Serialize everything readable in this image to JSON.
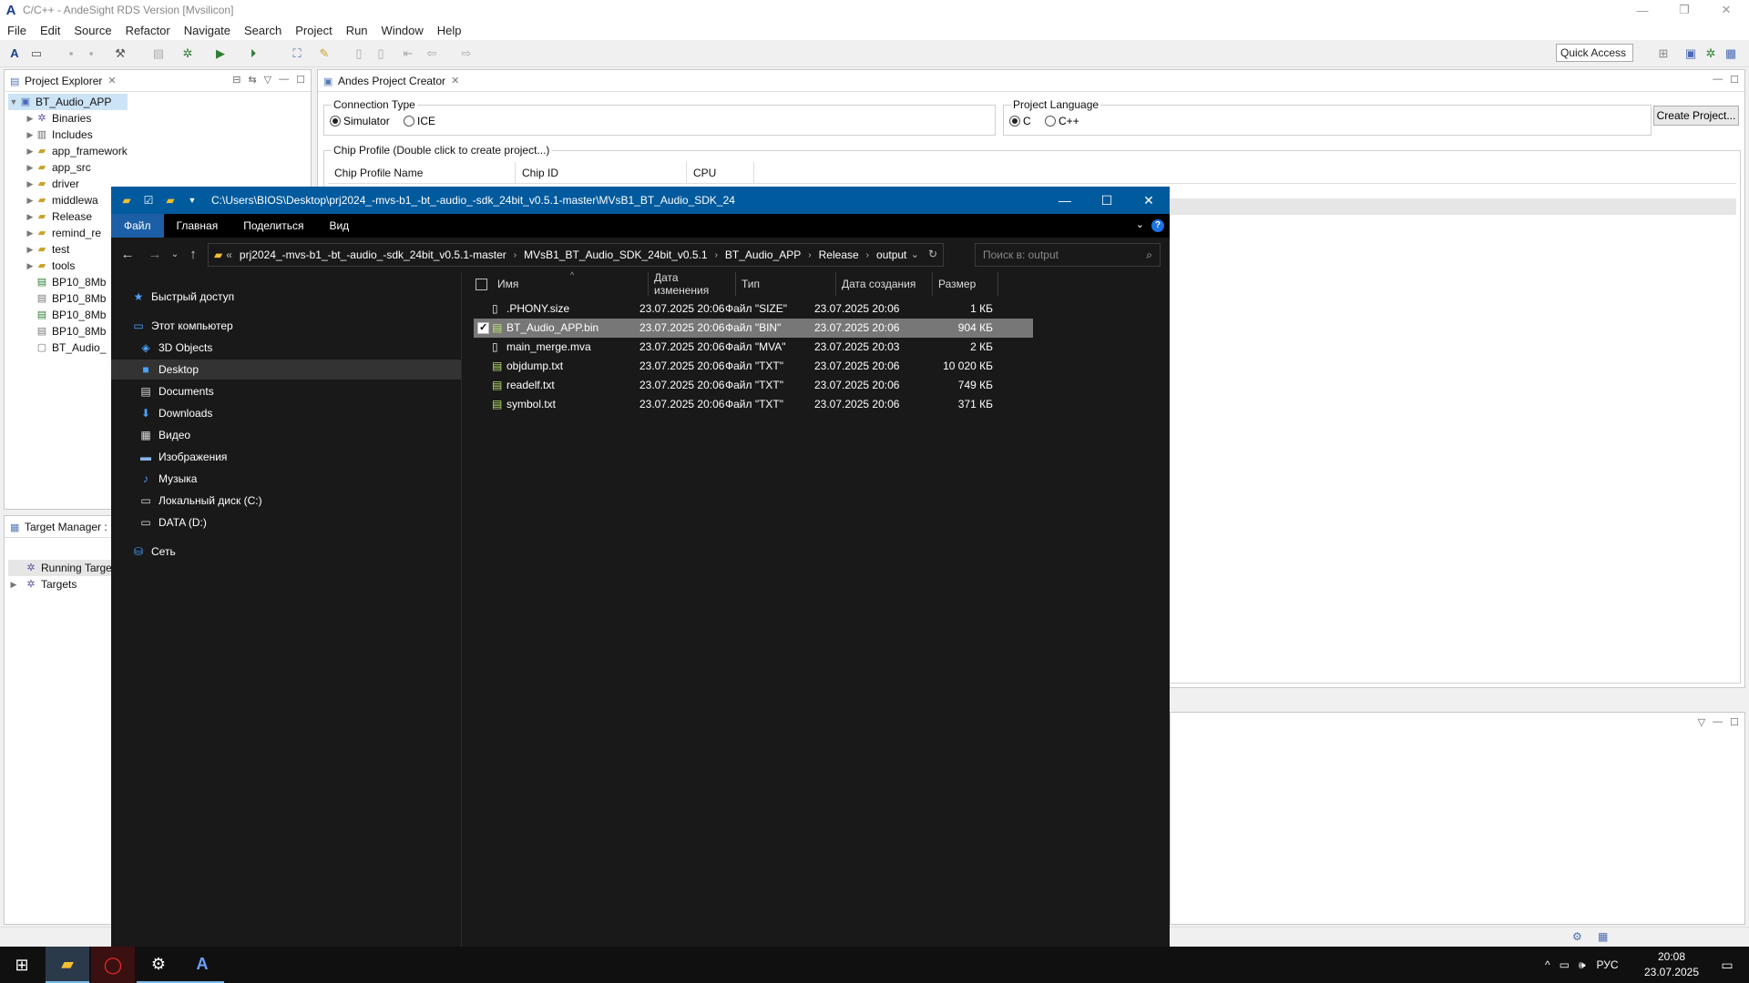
{
  "ide": {
    "window_title": "C/C++ - AndeSight RDS Version [Mvsilicon]",
    "menu": [
      "File",
      "Edit",
      "Source",
      "Refactor",
      "Navigate",
      "Search",
      "Project",
      "Run",
      "Window",
      "Help"
    ],
    "quick_access": "Quick Access",
    "project_explorer": {
      "tab_label": "Project Explorer",
      "root": "BT_Audio_APP",
      "items": [
        {
          "label": "Binaries",
          "icon": "binaries-icon"
        },
        {
          "label": "Includes",
          "icon": "includes-icon"
        },
        {
          "label": "app_framework",
          "icon": "folder-icon"
        },
        {
          "label": "app_src",
          "icon": "folder-icon"
        },
        {
          "label": "driver",
          "icon": "folder-icon"
        },
        {
          "label": "middlewa",
          "icon": "folder-icon"
        },
        {
          "label": "Release",
          "icon": "folder-icon"
        },
        {
          "label": "remind_re",
          "icon": "folder-icon"
        },
        {
          "label": "test",
          "icon": "folder-icon"
        },
        {
          "label": "tools",
          "icon": "folder-icon"
        },
        {
          "label": "BP10_8Mb",
          "icon": "file-icon"
        },
        {
          "label": "BP10_8Mb",
          "icon": "file-icon"
        },
        {
          "label": "BP10_8Mb",
          "icon": "file-icon"
        },
        {
          "label": "BP10_8Mb",
          "icon": "file-icon"
        },
        {
          "label": "BT_Audio_",
          "icon": "file-icon"
        }
      ]
    },
    "target_manager": {
      "tab_label": "Target Manager : L",
      "items": [
        "Running Targe",
        "Targets"
      ]
    },
    "creator": {
      "tab_label": "Andes Project Creator",
      "connection_type_label": "Connection Type",
      "connection_options": [
        "Simulator",
        "ICE"
      ],
      "connection_selected": "Simulator",
      "language_label": "Project Language",
      "language_options": [
        "C",
        "C++"
      ],
      "language_selected": "C",
      "create_button": "Create Project...",
      "chip_profile_label": "Chip Profile (Double click to create project...)",
      "columns": [
        "Chip Profile Name",
        "Chip ID",
        "CPU"
      ]
    }
  },
  "explorer": {
    "title_path": "C:\\Users\\BIOS\\Desktop\\prj2024_-mvs-b1_-bt_-audio_-sdk_24bit_v0.5.1-master\\MVsB1_BT_Audio_SDK_24",
    "ribbon_tabs": [
      "Файл",
      "Главная",
      "Поделиться",
      "Вид"
    ],
    "breadcrumb": [
      "prj2024_-mvs-b1_-bt_-audio_-sdk_24bit_v0.5.1-master",
      "MVsB1_BT_Audio_SDK_24bit_v0.5.1",
      "BT_Audio_APP",
      "Release",
      "output"
    ],
    "breadcrumb_overflow": "«",
    "search_placeholder": "Поиск в: output",
    "nav": {
      "quick_access": "Быстрый доступ",
      "this_pc": "Этот компьютер",
      "items": [
        {
          "label": "3D Objects",
          "icon": "3d-objects-icon"
        },
        {
          "label": "Desktop",
          "icon": "desktop-icon"
        },
        {
          "label": "Documents",
          "icon": "documents-icon"
        },
        {
          "label": "Downloads",
          "icon": "downloads-icon"
        },
        {
          "label": "Видео",
          "icon": "video-icon"
        },
        {
          "label": "Изображения",
          "icon": "pictures-icon"
        },
        {
          "label": "Музыка",
          "icon": "music-icon"
        },
        {
          "label": "Локальный диск (C:)",
          "icon": "drive-c-icon"
        },
        {
          "label": "DATA (D:)",
          "icon": "drive-d-icon"
        }
      ],
      "selected": "Desktop",
      "network": "Сеть"
    },
    "columns": [
      "Имя",
      "Дата изменения",
      "Тип",
      "Дата создания",
      "Размер"
    ],
    "files": [
      {
        "name": ".PHONY.size",
        "modified": "23.07.2025 20:06",
        "type": "Файл \"SIZE\"",
        "created": "23.07.2025 20:06",
        "size": "1 КБ"
      },
      {
        "name": "BT_Audio_APP.bin",
        "modified": "23.07.2025 20:06",
        "type": "Файл \"BIN\"",
        "created": "23.07.2025 20:06",
        "size": "904 КБ"
      },
      {
        "name": "main_merge.mva",
        "modified": "23.07.2025 20:06",
        "type": "Файл \"MVA\"",
        "created": "23.07.2025 20:03",
        "size": "2 КБ"
      },
      {
        "name": "objdump.txt",
        "modified": "23.07.2025 20:06",
        "type": "Файл \"TXT\"",
        "created": "23.07.2025 20:06",
        "size": "10 020 КБ"
      },
      {
        "name": "readelf.txt",
        "modified": "23.07.2025 20:06",
        "type": "Файл \"TXT\"",
        "created": "23.07.2025 20:06",
        "size": "749 КБ"
      },
      {
        "name": "symbol.txt",
        "modified": "23.07.2025 20:06",
        "type": "Файл \"TXT\"",
        "created": "23.07.2025 20:06",
        "size": "371 КБ"
      }
    ],
    "selected_file": "BT_Audio_APP.bin"
  },
  "taskbar": {
    "language": "РУС",
    "time": "20:08",
    "date": "23.07.2025"
  },
  "colors": {
    "explorer_title_bg": "#005a9e",
    "explorer_bg": "#191919",
    "ribbon_active": "#1c5fa6",
    "selection": "#777777"
  }
}
